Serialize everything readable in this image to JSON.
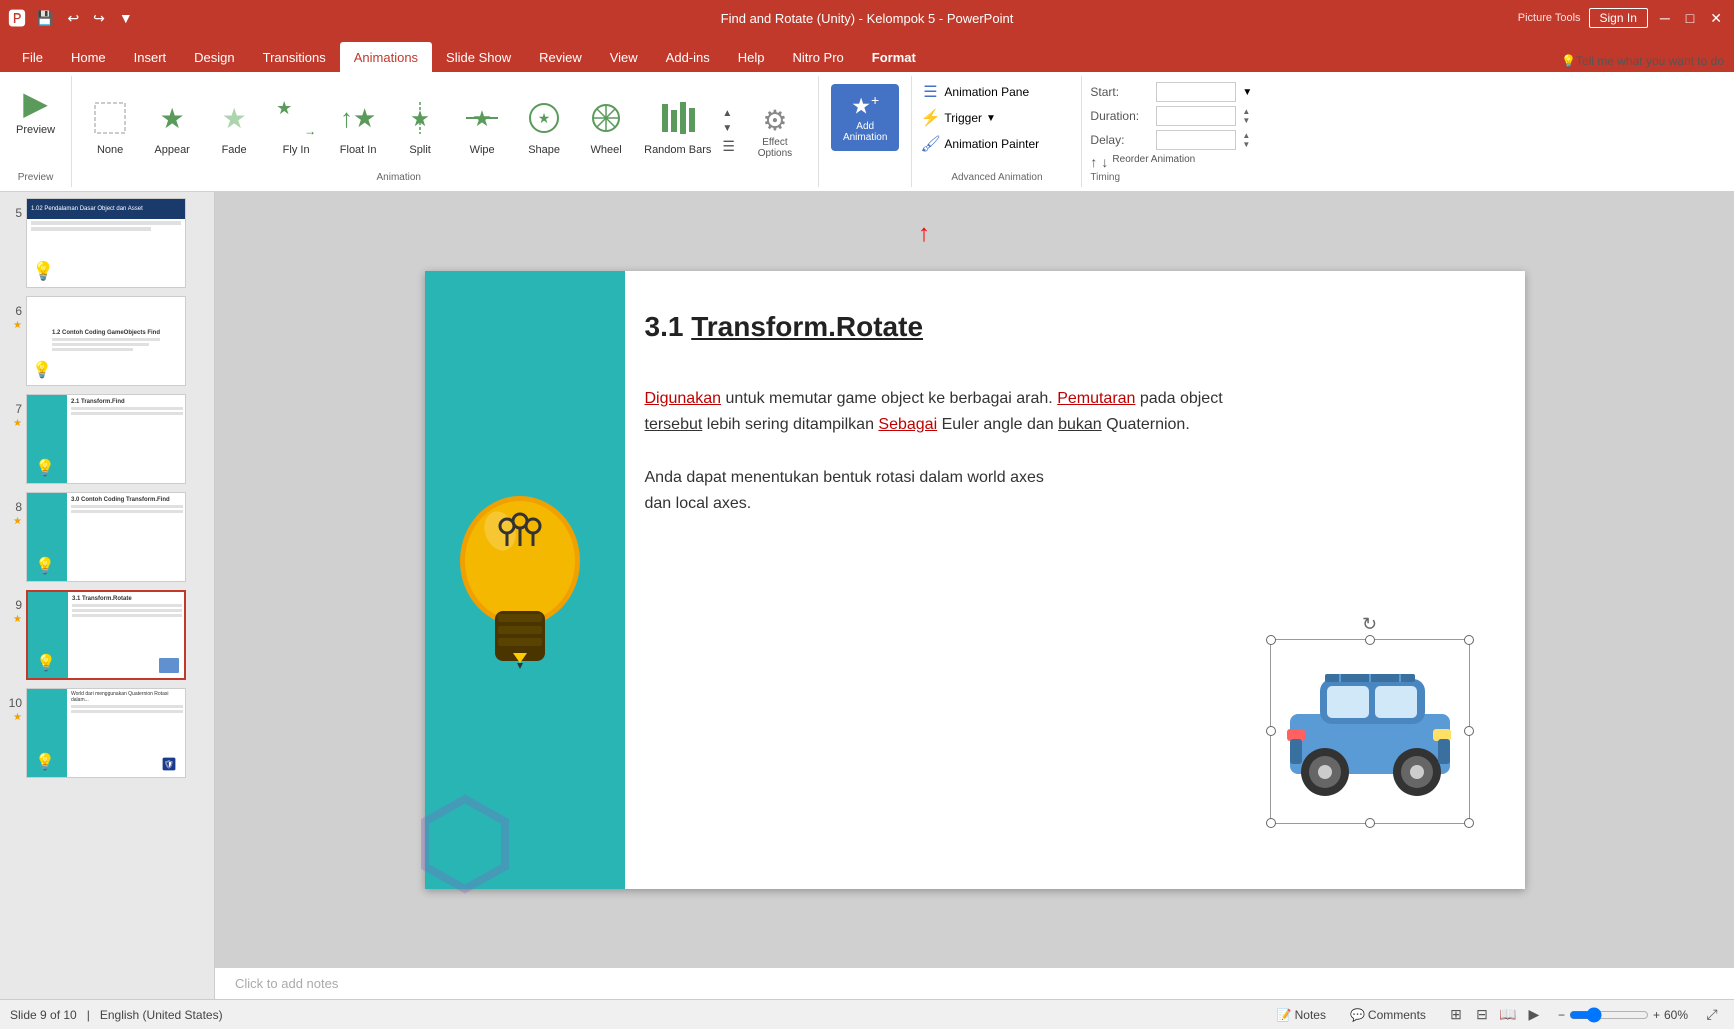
{
  "titlebar": {
    "title": "Find and Rotate (Unity) - Kelompok 5 - PowerPoint",
    "tools_label": "Picture Tools",
    "signin": "Sign In"
  },
  "quickaccess": [
    "save",
    "undo",
    "redo",
    "customize"
  ],
  "tabs": [
    {
      "id": "file",
      "label": "File"
    },
    {
      "id": "home",
      "label": "Home"
    },
    {
      "id": "insert",
      "label": "Insert"
    },
    {
      "id": "design",
      "label": "Design"
    },
    {
      "id": "transitions",
      "label": "Transitions"
    },
    {
      "id": "animations",
      "label": "Animations",
      "active": true
    },
    {
      "id": "slideshow",
      "label": "Slide Show"
    },
    {
      "id": "review",
      "label": "Review"
    },
    {
      "id": "view",
      "label": "View"
    },
    {
      "id": "addins",
      "label": "Add-ins"
    },
    {
      "id": "help",
      "label": "Help"
    },
    {
      "id": "nitropro",
      "label": "Nitro Pro"
    },
    {
      "id": "format",
      "label": "Format"
    }
  ],
  "ribbon": {
    "preview": {
      "label": "Preview",
      "btn": "Preview"
    },
    "animations": {
      "label": "Animation",
      "items": [
        {
          "id": "none",
          "label": "None",
          "icon": "✦"
        },
        {
          "id": "appear",
          "label": "Appear",
          "icon": "★"
        },
        {
          "id": "fade",
          "label": "Fade",
          "icon": "★"
        },
        {
          "id": "flyin",
          "label": "Fly In",
          "icon": "★"
        },
        {
          "id": "floatin",
          "label": "Float In",
          "icon": "★"
        },
        {
          "id": "split",
          "label": "Split",
          "icon": "★"
        },
        {
          "id": "wipe",
          "label": "Wipe",
          "icon": "★"
        },
        {
          "id": "shape",
          "label": "Shape",
          "icon": "★"
        },
        {
          "id": "wheel",
          "label": "Wheel",
          "icon": "★"
        },
        {
          "id": "randombars",
          "label": "Random Bars",
          "icon": "★"
        }
      ]
    },
    "effectoptions": {
      "label": "Effect Options",
      "icon": "⚙"
    },
    "addanimation": {
      "label": "Add Animation",
      "icon": "★"
    },
    "advanced": {
      "label": "Advanced Animation",
      "items": [
        {
          "id": "animationpane",
          "label": "Animation Pane"
        },
        {
          "id": "trigger",
          "label": "Trigger"
        },
        {
          "id": "animationpainter",
          "label": "Animation Painter"
        }
      ]
    },
    "timing": {
      "label": "Timing",
      "start_label": "Start:",
      "duration_label": "Duration:",
      "delay_label": "Delay:"
    }
  },
  "tell_me": "Tell me what you want to do",
  "slides": [
    {
      "num": 5,
      "has_star": false,
      "thumb_type": "blue_header"
    },
    {
      "num": 6,
      "has_star": true,
      "thumb_type": "text"
    },
    {
      "num": 7,
      "has_star": true,
      "thumb_type": "teal_left"
    },
    {
      "num": 8,
      "has_star": true,
      "thumb_type": "teal_left"
    },
    {
      "num": 9,
      "has_star": true,
      "thumb_type": "teal_left",
      "active": true
    },
    {
      "num": 10,
      "has_star": true,
      "thumb_type": "teal_left"
    }
  ],
  "slide": {
    "title": "3.1 Transform.Rotate",
    "title_underline": "Transform.Rotate",
    "body1": "Digunakan untuk memutar game object ke berbagai arah. Pemutaran pada object tersebut lebih sering ditampilkan Sebagai Euler angle dan bukan Quaternion.",
    "body2": "Anda dapat menentukan bentuk rotasi dalam world axes dan local axes.",
    "notes_placeholder": "Click to add notes"
  },
  "statusbar": {
    "slide_info": "Slide 9 of 10",
    "language": "English (United States)",
    "notes": "Notes",
    "comments": "Comments"
  }
}
